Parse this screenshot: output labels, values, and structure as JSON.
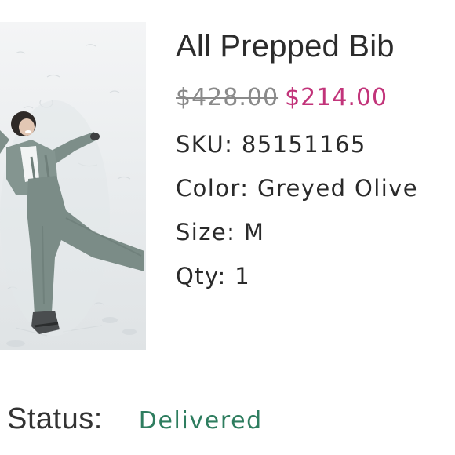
{
  "product": {
    "image_alt": "person lying in snow wearing bib",
    "title": "All Prepped Bib",
    "price_original": "$428.00",
    "price_sale": "$214.00",
    "sku_line": "SKU: 85151165",
    "color_line": "Color: Greyed Olive",
    "size_line": "Size: M",
    "qty_line": "Qty: 1"
  },
  "order": {
    "status_label": "Status:",
    "status_value": "Delivered"
  },
  "colors": {
    "sale_price": "#c2347a",
    "status_delivered": "#2e7d5f",
    "original_price": "#8a8a8a"
  }
}
